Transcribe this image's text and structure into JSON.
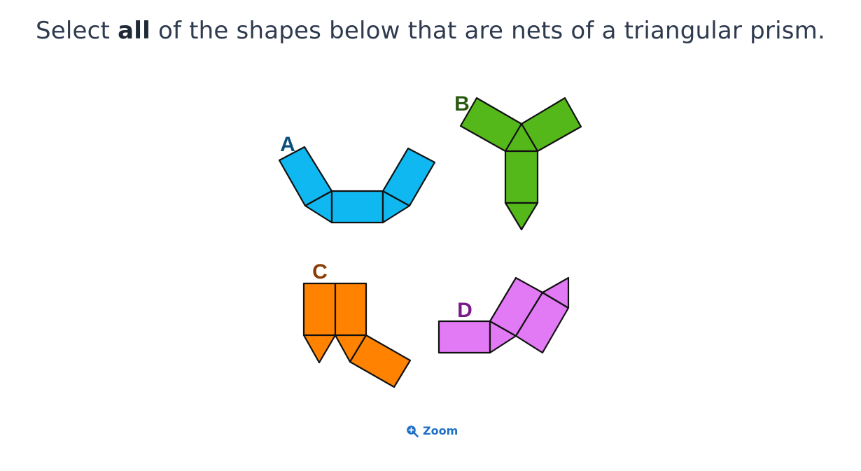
{
  "question": {
    "prefix": "Select ",
    "emphasis": "all",
    "suffix": " of the shapes below that are nets of a triangular prism."
  },
  "nets": [
    {
      "label": "A",
      "label_color": "#0b4f7d",
      "fill": "#0fb8f0"
    },
    {
      "label": "B",
      "label_color": "#2a5a12",
      "fill": "#55b81a"
    },
    {
      "label": "C",
      "label_color": "#8a3a05",
      "fill": "#ff8300"
    },
    {
      "label": "D",
      "label_color": "#7a1a8a",
      "fill": "#e27af5"
    }
  ],
  "zoom": {
    "label": "Zoom",
    "icon": "zoom-in-icon",
    "color": "#1e6fc8"
  }
}
